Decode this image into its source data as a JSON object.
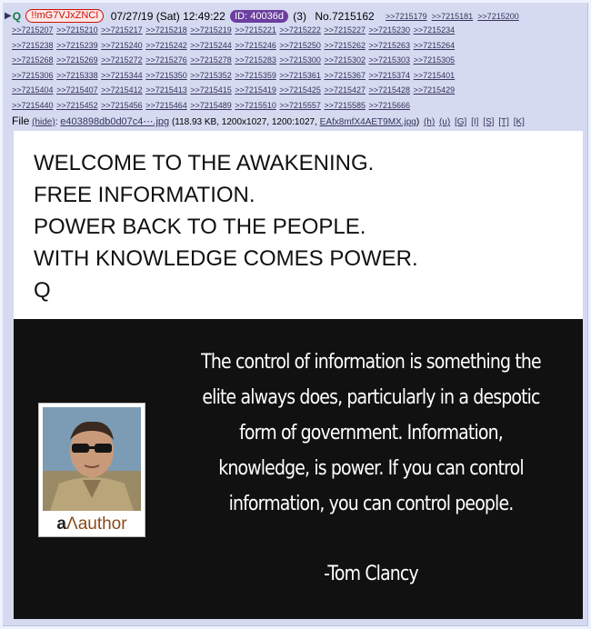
{
  "post": {
    "name": "Q",
    "tripcode": "!!mG7VJxZNCI",
    "date": "07/27/19 (Sat) 12:49:22",
    "poster_id": "ID: 40036d",
    "id_count": "(3)",
    "post_number": "No.7215162",
    "backlinks_first_row": [
      ">>7215179",
      ">>7215181",
      ">>7215200"
    ],
    "backlink_rows": [
      [
        ">>7215207",
        ">>7215210",
        ">>7215217",
        ">>7215218",
        ">>7215219",
        ">>7215221",
        ">>7215222",
        ">>7215227",
        ">>7215230",
        ">>7215234"
      ],
      [
        ">>7215238",
        ">>7215239",
        ">>7215240",
        ">>7215242",
        ">>7215244",
        ">>7215246",
        ">>7215250",
        ">>7215262",
        ">>7215263",
        ">>7215264"
      ],
      [
        ">>7215268",
        ">>7215269",
        ">>7215272",
        ">>7215276",
        ">>7215278",
        ">>7215283",
        ">>7215300",
        ">>7215302",
        ">>7215303",
        ">>7215305"
      ],
      [
        ">>7215306",
        ">>7215338",
        ">>7215344",
        ">>7215350",
        ">>7215352",
        ">>7215359",
        ">>7215361",
        ">>7215367",
        ">>7215374",
        ">>7215401"
      ],
      [
        ">>7215404",
        ">>7215407",
        ">>7215412",
        ">>7215413",
        ">>7215415",
        ">>7215419",
        ">>7215425",
        ">>7215427",
        ">>7215428",
        ">>7215429"
      ],
      [
        ">>7215440",
        ">>7215452",
        ">>7215456",
        ">>7215464",
        ">>7215489",
        ">>7215510",
        ">>7215557",
        ">>7215585",
        ">>7215666"
      ]
    ]
  },
  "file": {
    "label": "File",
    "hide_link": "(hide)",
    "filename": "e403898db0d07c4⋯.jpg",
    "meta": "(118.93 KB, 1200x1027, 1200:1027,",
    "original_name": "EAfx8mfX4AET9MX.jpg",
    "close_paren": ")",
    "tools": [
      "(h)",
      "(u)",
      "[G]",
      "[I]",
      "[S]",
      "[T]",
      "[K]"
    ]
  },
  "image": {
    "top_lines": [
      "WELCOME TO THE AWAKENING.",
      "FREE INFORMATION.",
      "POWER BACK TO THE PEOPLE.",
      "WITH KNOWLEDGE COMES POWER.",
      "Q"
    ],
    "quote_lines": [
      "The control of information is something the",
      "elite always does, particularly in a despotic",
      "form of government. Information,",
      "knowledge, is power. If you can control",
      "information, you can control people."
    ],
    "attribution": "-Tom Clancy",
    "brand_prefix": "a",
    "brand_mark": "Λ",
    "brand_suffix": "author"
  }
}
